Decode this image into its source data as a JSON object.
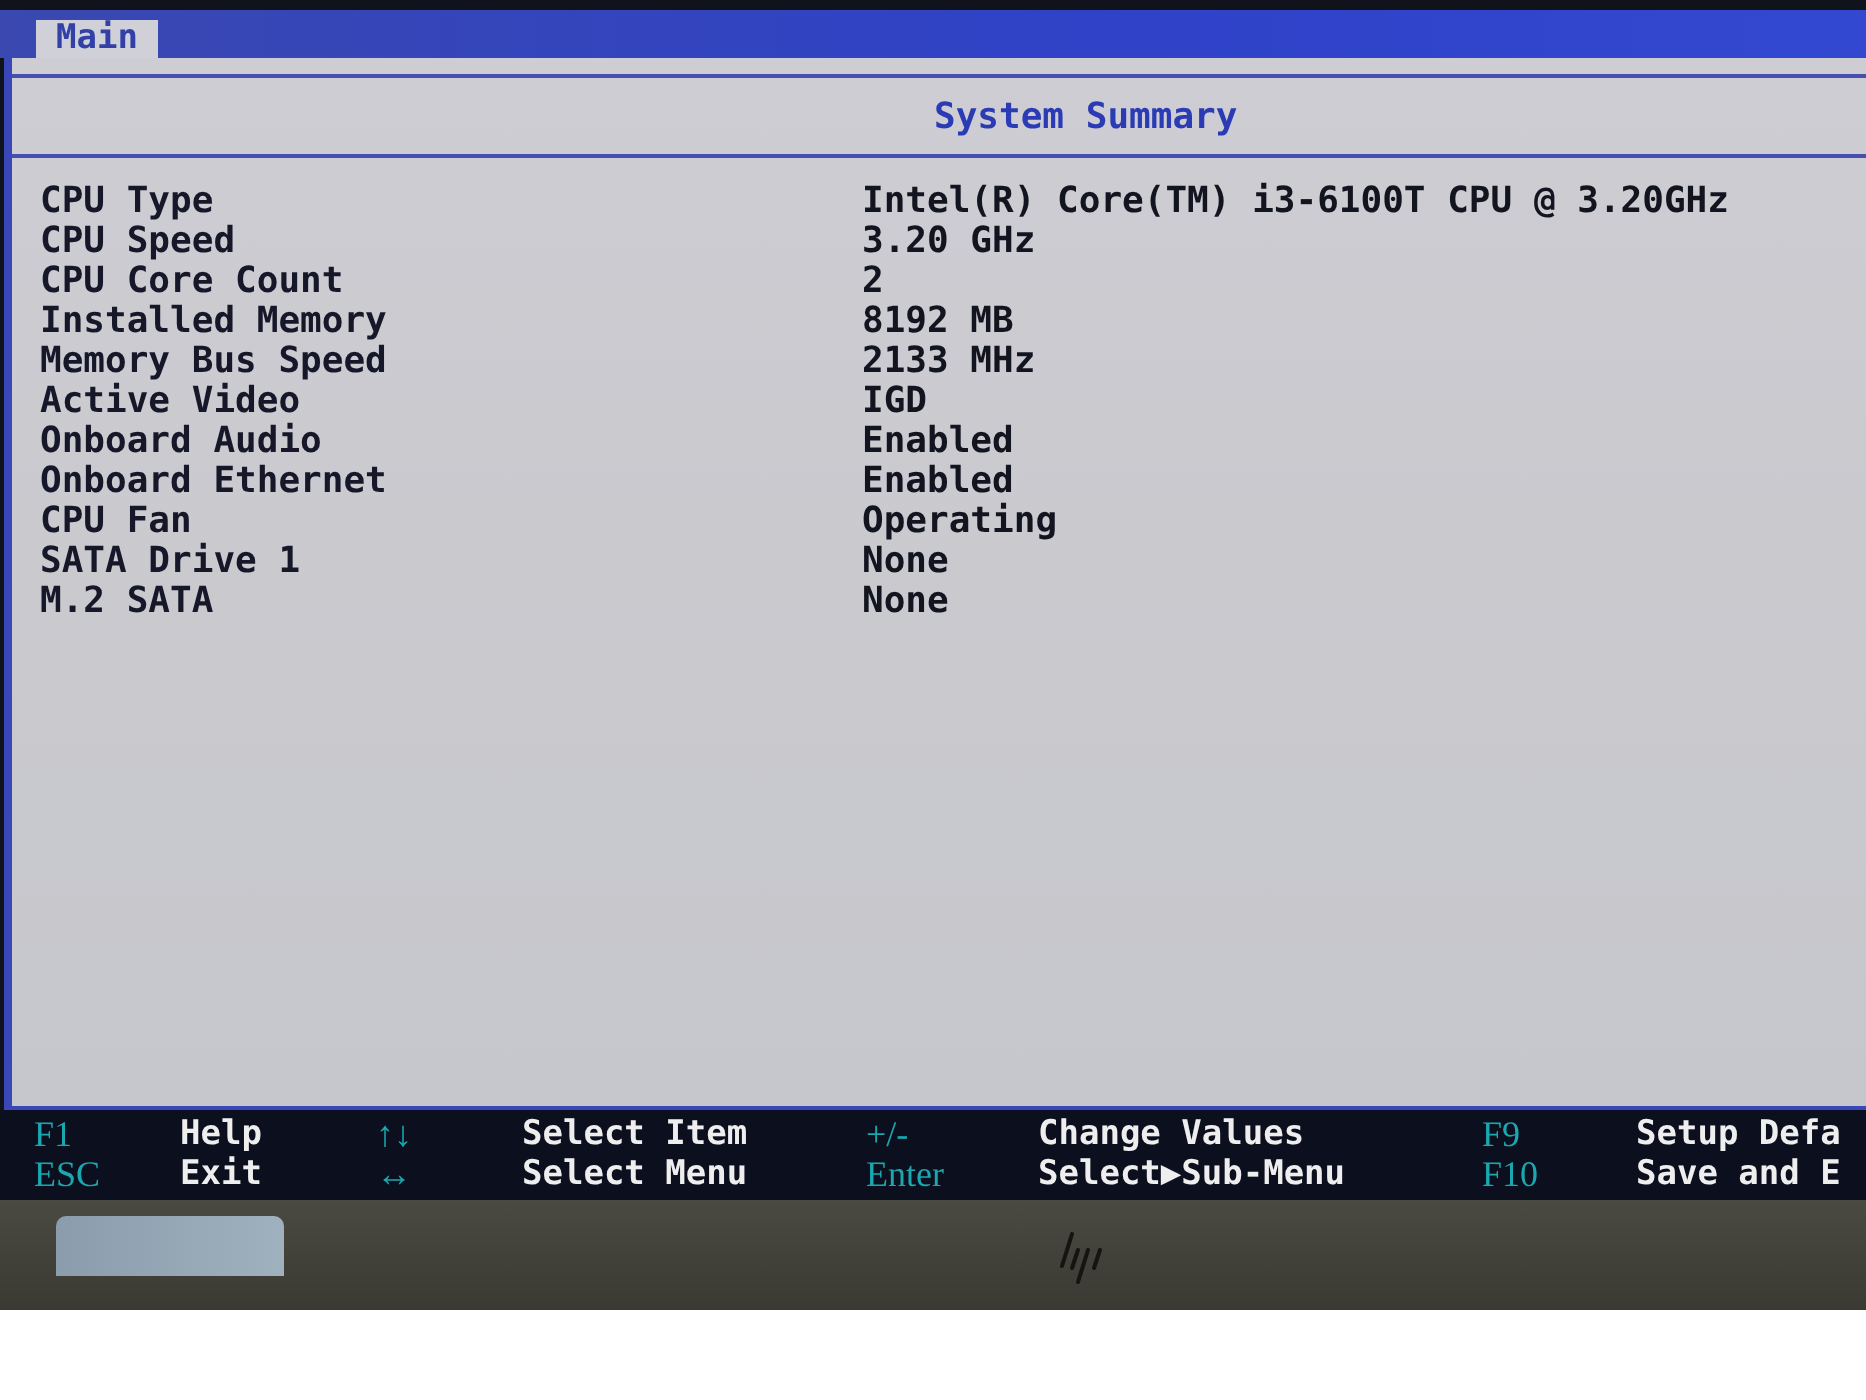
{
  "tabs": [
    {
      "label": "Main",
      "selected": true
    }
  ],
  "title": "System Summary",
  "items": [
    {
      "label": "CPU Type",
      "value": "Intel(R) Core(TM) i3-6100T CPU @ 3.20GHz"
    },
    {
      "label": "CPU Speed",
      "value": "3.20 GHz"
    },
    {
      "label": "CPU Core Count",
      "value": "2"
    },
    {
      "label": "Installed Memory",
      "value": "8192 MB"
    },
    {
      "label": "Memory Bus Speed",
      "value": "2133 MHz"
    },
    {
      "label": "Active Video",
      "value": "IGD"
    },
    {
      "label": "Onboard Audio",
      "value": "Enabled"
    },
    {
      "label": "Onboard Ethernet",
      "value": "Enabled"
    },
    {
      "label": "CPU Fan",
      "value": "Operating"
    },
    {
      "label": "SATA Drive 1",
      "value": "None"
    },
    {
      "label": "M.2 SATA",
      "value": "None"
    }
  ],
  "key_hints": [
    [
      {
        "key": "F1",
        "action": "Help"
      },
      {
        "key": "ESC",
        "action": "Exit"
      }
    ],
    [
      {
        "key": "↑↓",
        "action": "Select Item"
      },
      {
        "key": "↔",
        "action": "Select Menu"
      }
    ],
    [
      {
        "key": "+/-",
        "action": "Change Values"
      },
      {
        "key": "Enter",
        "action": "Select▶Sub-Menu"
      }
    ],
    [
      {
        "key": "F9",
        "action": "Setup Defa"
      },
      {
        "key": "F10",
        "action": "Save and E"
      }
    ]
  ]
}
